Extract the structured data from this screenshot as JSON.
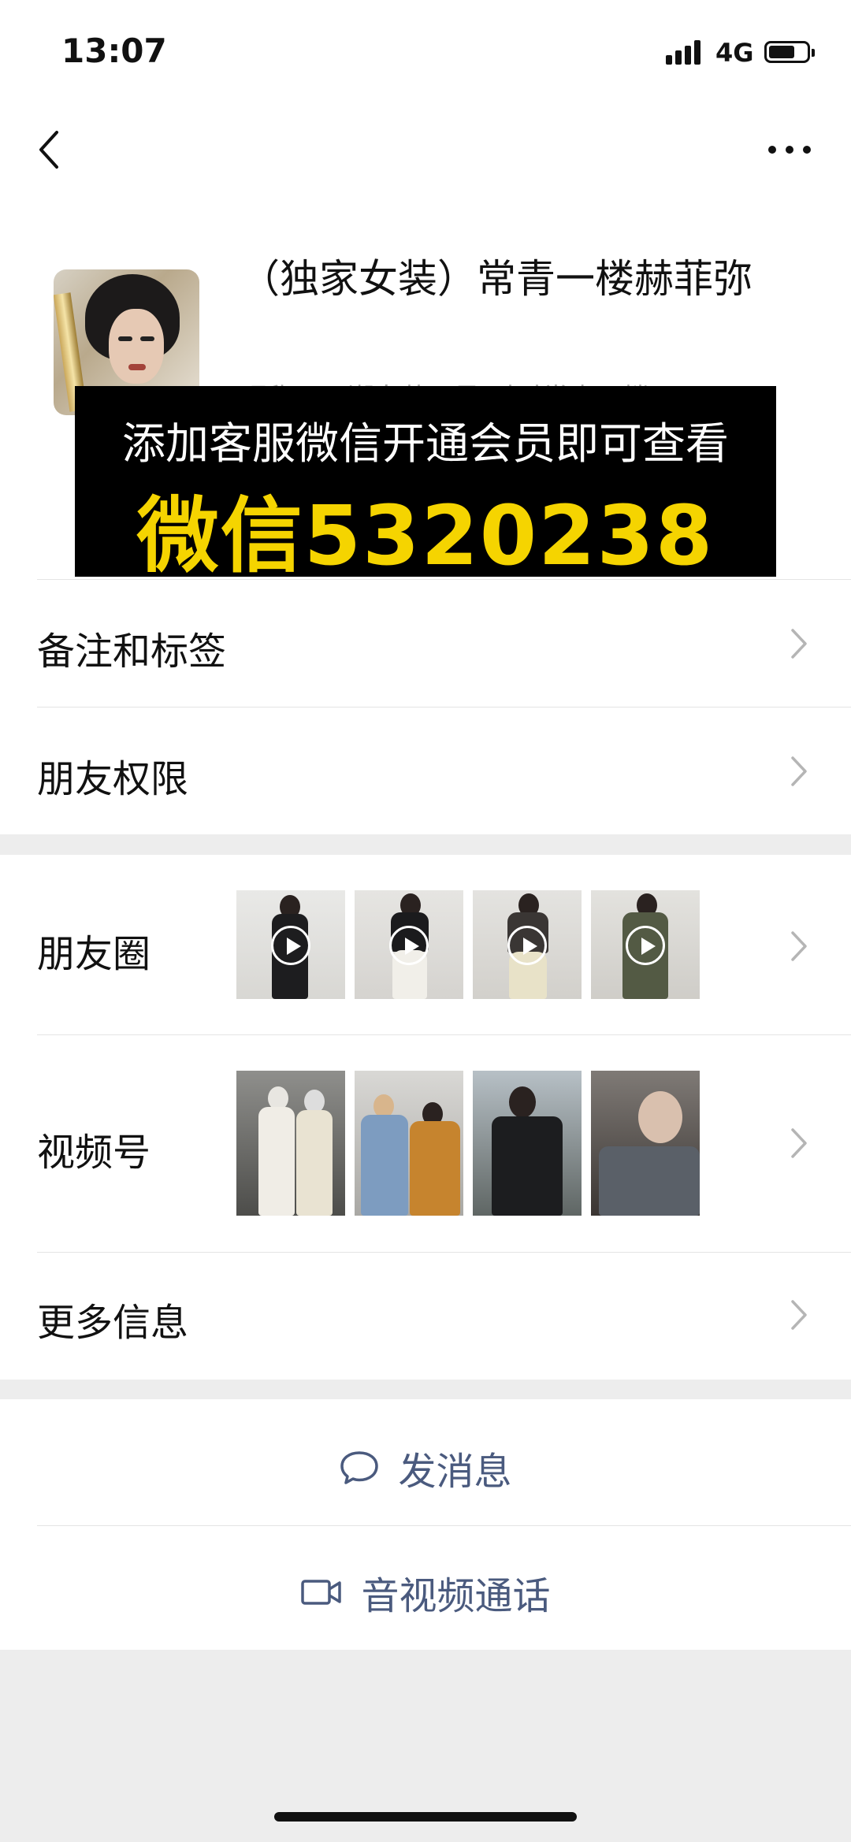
{
  "status": {
    "time": "13:07",
    "network": "4G"
  },
  "profile": {
    "name": "（独家女装）常青一楼赫菲弥",
    "subtext": "昵称：…潮女装·1号·时时常青一楼"
  },
  "promo": {
    "line1": "添加客服微信开通会员即可查看",
    "line2": "微信5320238",
    "highlight_color": "#f5d400"
  },
  "menu": {
    "remark": "备注和标签",
    "permission": "朋友权限",
    "moments": "朋友圈",
    "channels": "视频号",
    "more_info": "更多信息"
  },
  "actions": {
    "message": "发消息",
    "call": "音视频通话"
  },
  "colors": {
    "accent": "#4a5a7e",
    "background": "#ededed"
  }
}
